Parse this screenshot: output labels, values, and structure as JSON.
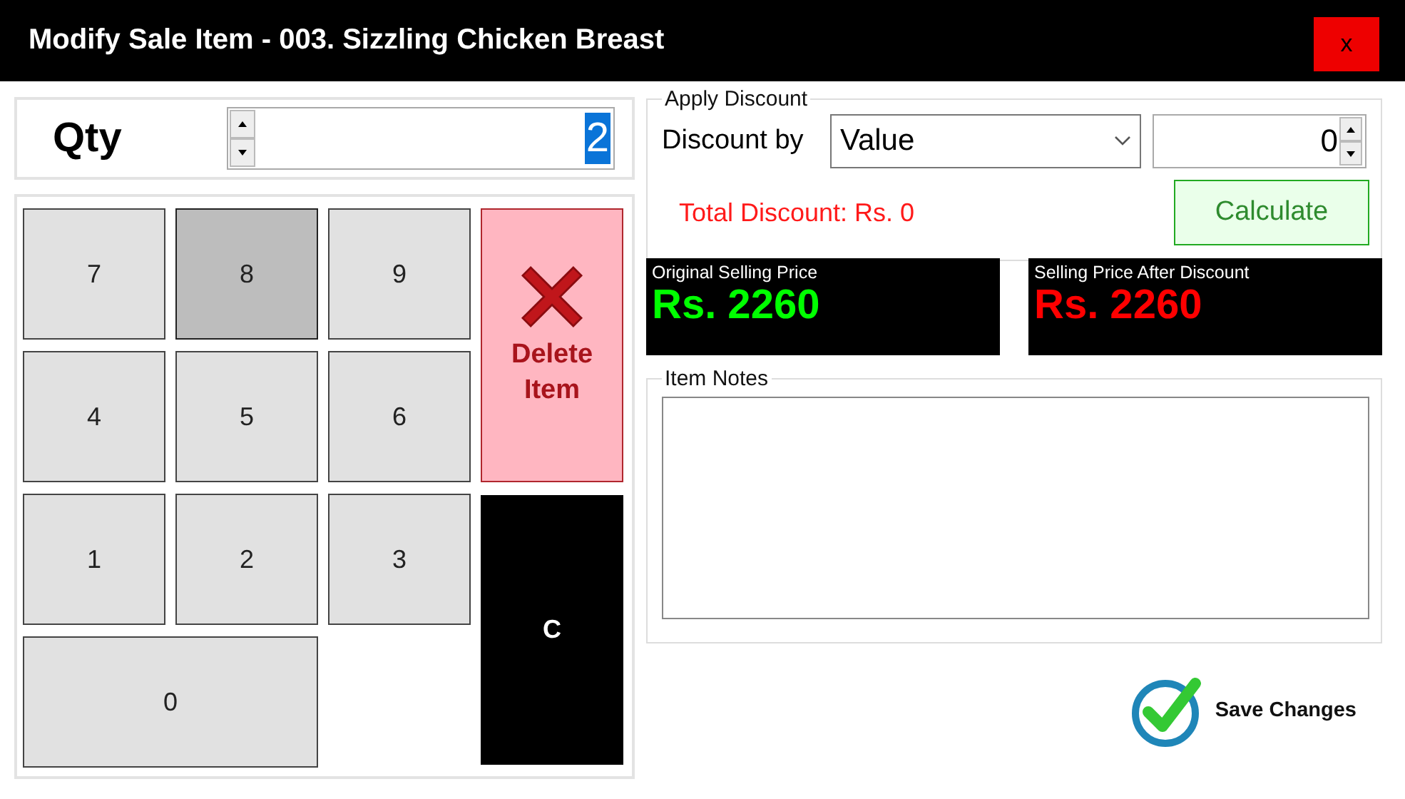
{
  "window": {
    "title": "Modify Sale Item - 003. Sizzling Chicken Breast",
    "close": "x"
  },
  "qty": {
    "label": "Qty",
    "value": "2"
  },
  "keypad": [
    {
      "label": "7",
      "selected": false
    },
    {
      "label": "8",
      "selected": true
    },
    {
      "label": "9",
      "selected": false
    },
    {
      "label": "4",
      "selected": false
    },
    {
      "label": "5",
      "selected": false
    },
    {
      "label": "6",
      "selected": false
    },
    {
      "label": "1",
      "selected": false
    },
    {
      "label": "2",
      "selected": false
    },
    {
      "label": "3",
      "selected": false
    },
    {
      "label": "0",
      "selected": false
    }
  ],
  "delete_button": "Delete Item",
  "clear_button": "C",
  "discount": {
    "title": "Apply Discount",
    "label": "Discount by",
    "type": "Value",
    "amount": "0",
    "total": "Total Discount: Rs. 0",
    "calculate": "Calculate"
  },
  "prices": [
    {
      "label": "Original Selling Price",
      "value": "Rs. 2260",
      "color": "#00ff00"
    },
    {
      "label": "Selling Price After Discount",
      "value": "Rs. 2260",
      "color": "#ff0000"
    }
  ],
  "notes": {
    "title": "Item Notes"
  },
  "save_button": "Save Changes"
}
